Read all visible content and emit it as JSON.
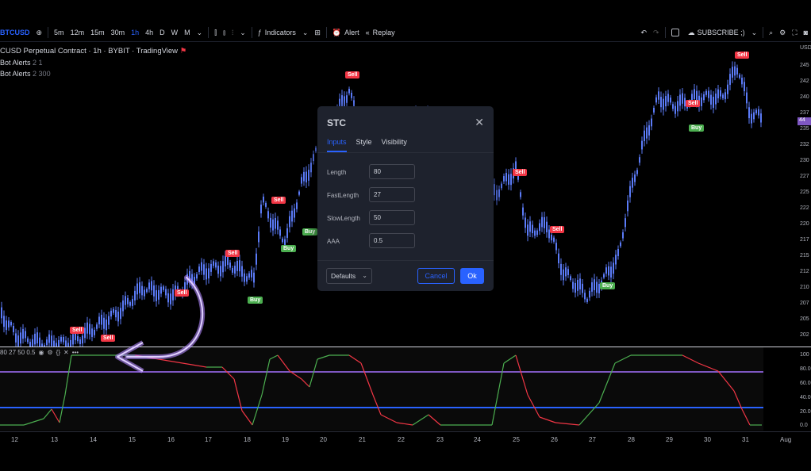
{
  "toolbar": {
    "symbol": "BTCUSD",
    "intervals": [
      "5m",
      "12m",
      "15m",
      "30m",
      "1h",
      "4h",
      "D",
      "W",
      "M"
    ],
    "active_interval": "1h",
    "indicators_label": "Indicators",
    "alert_label": "Alert",
    "replay_label": "Replay",
    "subscribe_label": "SUBSCRIBE ;)"
  },
  "legend": {
    "title": "CUSD Perpetual Contract · 1h · BYBIT · TradingView",
    "line1_name": "Bot Alerts",
    "line1_vals": "2 1",
    "line2_name": "Bot Alerts",
    "line2_vals": "2 300"
  },
  "price_axis": {
    "labels": [
      "USD",
      "245",
      "242",
      "240",
      "237",
      "235",
      "232",
      "230",
      "227",
      "225",
      "222",
      "220",
      "217",
      "215",
      "212",
      "210",
      "207",
      "205",
      "202"
    ],
    "current_tag": "44"
  },
  "osc_axis": {
    "labels": [
      "100",
      "80.0",
      "60.0",
      "40.0",
      "20.0",
      "0.0"
    ]
  },
  "osc_legend": {
    "params": "80 27 50 0.5"
  },
  "time_axis": {
    "labels": [
      "12",
      "13",
      "14",
      "15",
      "16",
      "17",
      "18",
      "19",
      "20",
      "21",
      "22",
      "23",
      "24",
      "25",
      "26",
      "27",
      "28",
      "29",
      "30",
      "31",
      "Aug"
    ]
  },
  "signals": {
    "sell": "Sell",
    "buy": "Buy"
  },
  "dialog": {
    "title": "STC",
    "tabs": [
      "Inputs",
      "Style",
      "Visibility"
    ],
    "active_tab": "Inputs",
    "fields": [
      {
        "label": "Length",
        "value": "80"
      },
      {
        "label": "FastLength",
        "value": "27"
      },
      {
        "label": "SlowLength",
        "value": "50"
      },
      {
        "label": "AAA",
        "value": "0.5"
      }
    ],
    "defaults_label": "Defaults",
    "cancel_label": "Cancel",
    "ok_label": "Ok"
  },
  "colors": {
    "accent": "#2962ff",
    "candle_up": "#5b7bf7",
    "sell": "#f23645",
    "buy": "#4caf50",
    "upper_band": "#7e57c2",
    "lower_band": "#2962ff",
    "stc_up": "#4caf50",
    "stc_down": "#f23645",
    "arrow": "#b388ff"
  }
}
